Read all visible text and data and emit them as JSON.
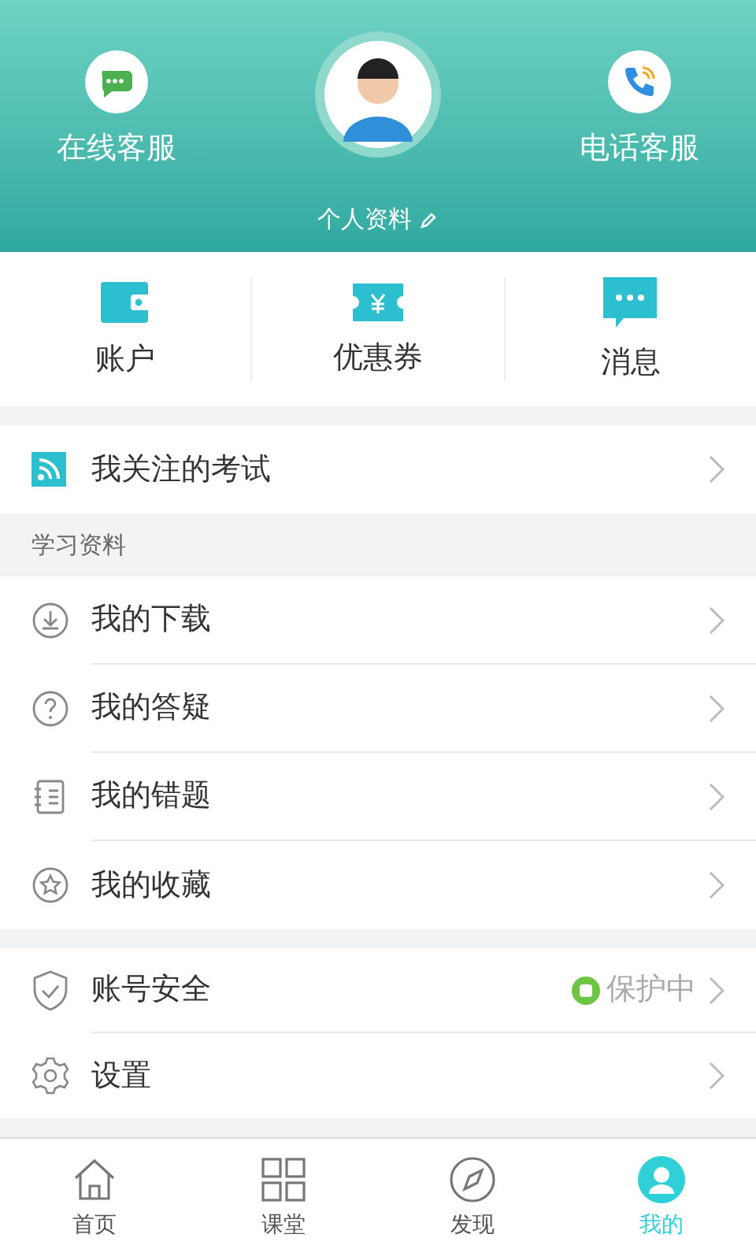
{
  "header": {
    "online_service": "在线客服",
    "phone_service": "电话客服",
    "profile_link": "个人资料"
  },
  "shortcuts": [
    {
      "kind": "wallet",
      "label": "账户"
    },
    {
      "kind": "coupon",
      "label": "优惠券"
    },
    {
      "kind": "message",
      "label": "消息"
    }
  ],
  "followed_exams": {
    "label": "我关注的考试"
  },
  "study_section": {
    "title": "学习资料",
    "items": [
      {
        "kind": "download",
        "label": "我的下载"
      },
      {
        "kind": "question",
        "label": "我的答疑"
      },
      {
        "kind": "mistakes",
        "label": "我的错题"
      },
      {
        "kind": "favorites",
        "label": "我的收藏"
      }
    ]
  },
  "account_items": [
    {
      "kind": "security",
      "label": "账号安全",
      "status": "保护中"
    },
    {
      "kind": "settings",
      "label": "设置"
    }
  ],
  "tab_bar": [
    {
      "kind": "home",
      "label": "首页",
      "selected": false
    },
    {
      "kind": "classroom",
      "label": "课堂",
      "selected": false
    },
    {
      "kind": "discover",
      "label": "发现",
      "selected": false
    },
    {
      "kind": "mine",
      "label": "我的",
      "selected": true
    }
  ]
}
